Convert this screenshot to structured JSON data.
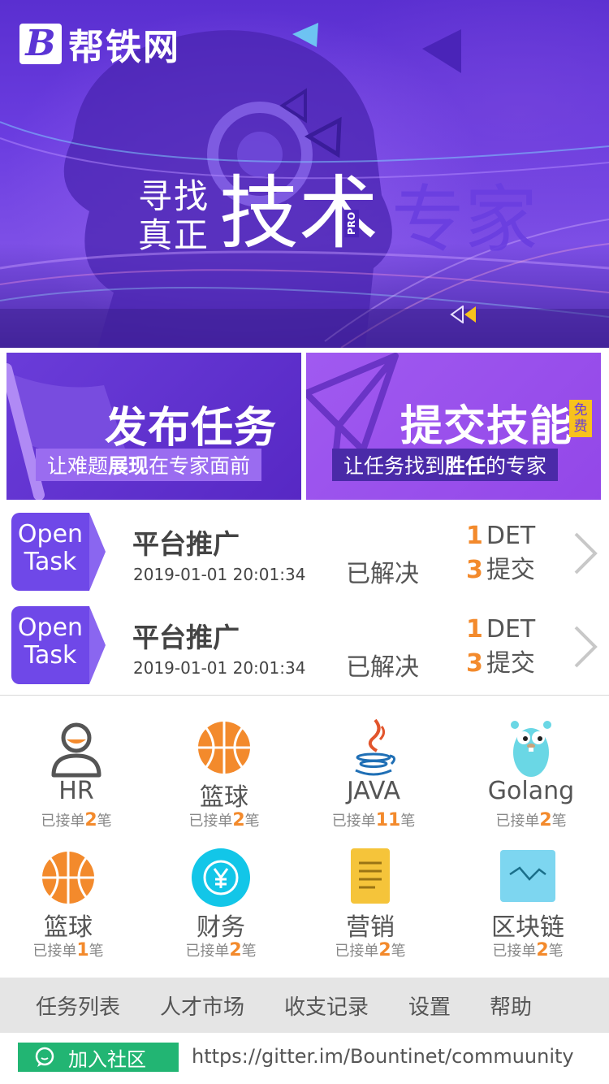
{
  "header": {
    "logo_letter": "B",
    "logo_text": "帮铁网"
  },
  "hero": {
    "slogan_line1": "寻找",
    "slogan_line2": "真正",
    "slogan_big": "技术",
    "slogan_pro": "PRO",
    "slogan_after": "专家"
  },
  "banners": {
    "publish": {
      "title": "发布任务",
      "sub_pre": "让难题",
      "sub_bold": "展现",
      "sub_post": "在专家面前"
    },
    "submit": {
      "title": "提交技能",
      "badge": "免费",
      "sub_pre": "让任务找到",
      "sub_bold": "胜任",
      "sub_post": "的专家"
    }
  },
  "tasks": [
    {
      "badge_line1": "Open",
      "badge_line2": "Task",
      "title": "平台推广",
      "time": "2019-01-01 20:01:34",
      "status": "已解决",
      "amount": "1",
      "amount_unit": "DET",
      "submissions": "3",
      "submissions_unit": "提交"
    },
    {
      "badge_line1": "Open",
      "badge_line2": "Task",
      "title": "平台推广",
      "time": "2019-01-01 20:01:34",
      "status": "已解决",
      "amount": "1",
      "amount_unit": "DET",
      "submissions": "3",
      "submissions_unit": "提交"
    }
  ],
  "categories": [
    {
      "name": "HR",
      "icon": "user-icon",
      "count_pre": "已接单",
      "count": "2",
      "count_post": "笔"
    },
    {
      "name": "篮球",
      "icon": "basketball-icon",
      "count_pre": "已接单",
      "count": "2",
      "count_post": "笔"
    },
    {
      "name": "JAVA",
      "icon": "java-icon",
      "count_pre": "已接单",
      "count": "11",
      "count_post": "笔"
    },
    {
      "name": "Golang",
      "icon": "gopher-icon",
      "count_pre": "已接单",
      "count": "2",
      "count_post": "笔"
    },
    {
      "name": "篮球",
      "icon": "basketball-icon",
      "count_pre": "已接单",
      "count": "1",
      "count_post": "笔"
    },
    {
      "name": "财务",
      "icon": "yen-coin-icon",
      "count_pre": "已接单",
      "count": "2",
      "count_post": "笔"
    },
    {
      "name": "营销",
      "icon": "notepad-icon",
      "count_pre": "已接单",
      "count": "2",
      "count_post": "笔"
    },
    {
      "name": "区块链",
      "icon": "blockchain-chart-icon",
      "count_pre": "已接单",
      "count": "2",
      "count_post": "笔"
    }
  ],
  "nav": [
    "任务列表",
    "人才市场",
    "收支记录",
    "设置",
    "帮助"
  ],
  "community": {
    "join_label": "加入社区",
    "url": "https://gitter.im/Bountinet/commuunity"
  },
  "colors": {
    "brand_purple": "#6f48e8",
    "accent_orange": "#f38a2c",
    "community_green": "#22b573",
    "badge_yellow": "#f7c21c"
  }
}
